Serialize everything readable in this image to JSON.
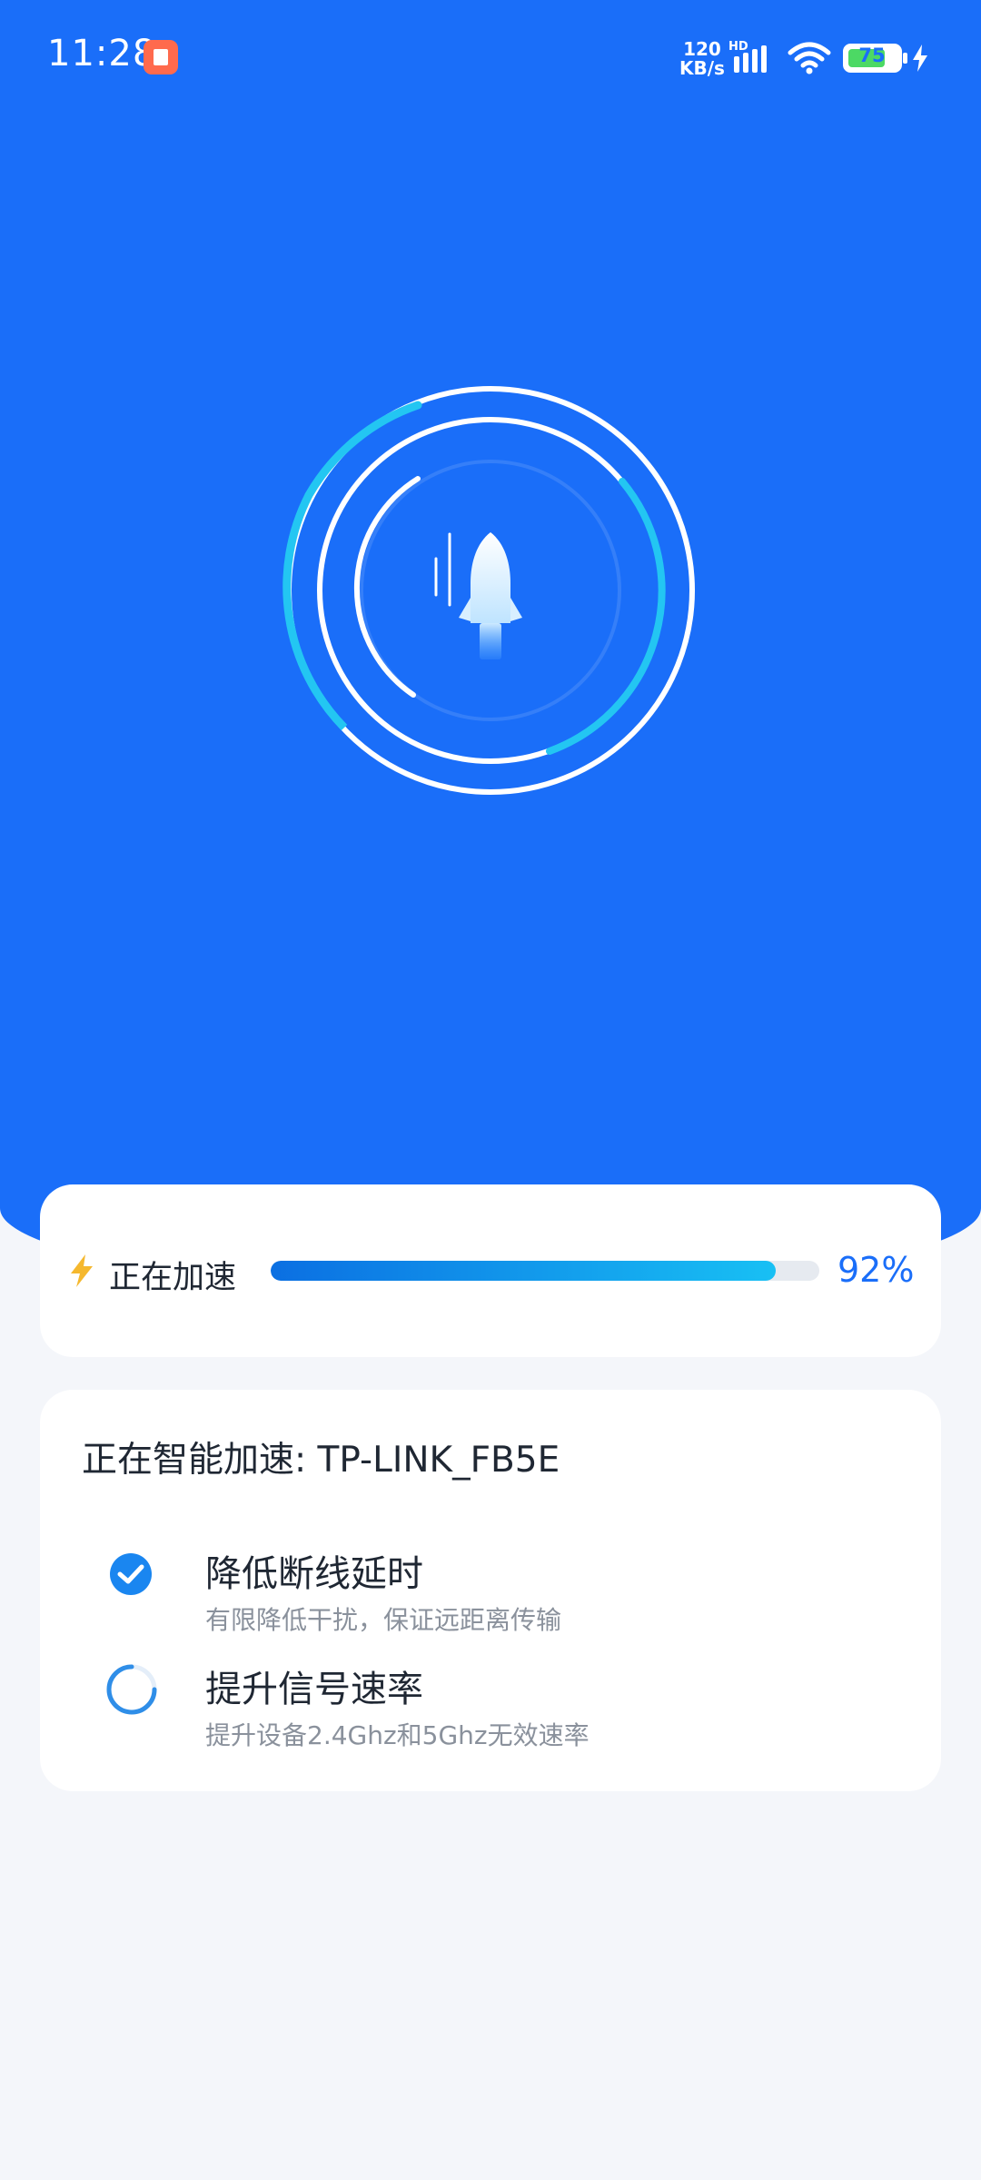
{
  "status_bar": {
    "time": "11:28",
    "notification_icon": "app-notification-icon",
    "net_speed_value": "120",
    "net_speed_unit": "KB/s",
    "network_label": "HD",
    "battery_level": "75",
    "charging": true
  },
  "accelerate": {
    "label": "正在加速",
    "progress_text": "92%",
    "progress": 0.92,
    "colors": {
      "hero": "#1a6ef9",
      "progress_start": "#0b6fe2",
      "progress_end": "#18c0f4"
    }
  },
  "tasks": {
    "title": "正在智能加速: TP-LINK_FB5E",
    "items": [
      {
        "title": "降低断线延时",
        "desc": "有限降低干扰，保证远距离传输",
        "status": "done"
      },
      {
        "title": "提升信号速率",
        "desc": "提升设备2.4Ghz和5Ghz无效速率",
        "status": "loading"
      }
    ]
  }
}
